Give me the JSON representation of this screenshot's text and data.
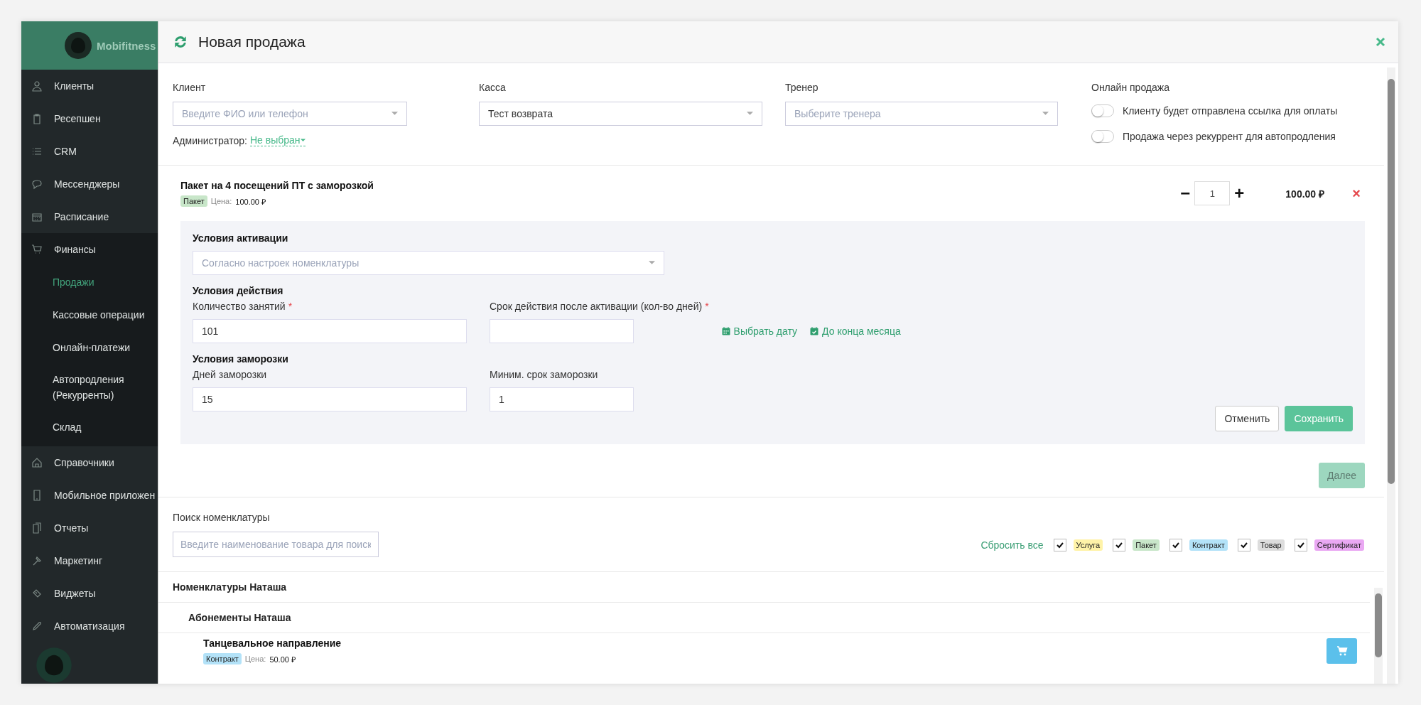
{
  "sidebar": {
    "brand": "Mobifitness",
    "items": [
      {
        "label": "Клиенты",
        "selected": false
      },
      {
        "label": "Ресепшен",
        "selected": false
      },
      {
        "label": "CRM",
        "selected": false
      },
      {
        "label": "Мессенджеры",
        "selected": false
      },
      {
        "label": "Расписание",
        "selected": false
      },
      {
        "label": "Финансы",
        "selected": false,
        "expanded": true,
        "children": [
          {
            "label": "Продажи",
            "selected": true
          },
          {
            "label": "Кассовые операции",
            "selected": false
          },
          {
            "label": "Онлайн-платежи",
            "selected": false
          },
          {
            "label": "Автопродления (Рекурренты)",
            "selected": false
          },
          {
            "label": "Склад",
            "selected": false
          }
        ]
      },
      {
        "label": "Справочники",
        "selected": false
      },
      {
        "label": "Мобильное приложен",
        "selected": false
      },
      {
        "label": "Отчеты",
        "selected": false
      },
      {
        "label": "Маркетинг",
        "selected": false
      },
      {
        "label": "Виджеты",
        "selected": false
      },
      {
        "label": "Автоматизация",
        "selected": false
      }
    ]
  },
  "modal": {
    "title": "Новая продажа",
    "fields": [
      {
        "label": "Клиент",
        "placeholder": "Введите ФИО или телефон"
      },
      {
        "label": "Касса",
        "value": "Тест возврата"
      },
      {
        "label": "Тренер",
        "placeholder": "Выберите тренера"
      }
    ],
    "administrator": {
      "label": "Администратор:",
      "value": "Не выбран"
    },
    "online": {
      "label": "Онлайн продажа",
      "toggles": [
        {
          "label": "Клиенту будет отправлена ссылка для оплаты",
          "on": false
        },
        {
          "label": "Продажа через рекуррент для автопродления",
          "on": false
        }
      ]
    },
    "item": {
      "title": "Пакет на 4 посещений ПТ с заморозкой",
      "tag": {
        "label": "Пакет",
        "color": "#c8e6c9"
      },
      "price_label": "Цена:",
      "price": "100.00 ₽",
      "quantity": "1",
      "minus": "−",
      "plus": "+",
      "total": "100.00 ₽",
      "remove": "×",
      "activation": {
        "heading": "Условия активации",
        "placeholder": "Согласно настроек номенклатуры"
      },
      "action": {
        "heading": "Условия действия",
        "fields": [
          {
            "label": "Количество занятий",
            "required_mark": "*",
            "value": "101"
          },
          {
            "label": "Срок действия после активации (кол-во дней)",
            "required_mark": "*"
          }
        ],
        "links": [
          "Выбрать дату",
          "До конца месяца"
        ]
      },
      "freeze": {
        "heading": "Условия заморозки",
        "fields": [
          {
            "label": "Дней заморозки",
            "value": "15"
          },
          {
            "label": "Миним. срок заморозки",
            "value": "1"
          }
        ]
      },
      "cancel": "Отменить",
      "save": "Сохранить"
    },
    "next": {
      "label": "Далее",
      "disabled": true
    },
    "search": {
      "label": "Поиск номенклатуры",
      "placeholder": "Введите наименование товара для поиск"
    },
    "reset": "Сбросить все",
    "filters": [
      {
        "label": "Услуга",
        "color": "#fff3a8",
        "checked": true
      },
      {
        "label": "Пакет",
        "color": "#c8e6c9",
        "checked": true
      },
      {
        "label": "Контракт",
        "color": "#b3e2f8",
        "checked": true
      },
      {
        "label": "Товар",
        "color": "#dddddd",
        "checked": true
      },
      {
        "label": "Сертификат",
        "color": "#eaa8f3",
        "checked": true
      }
    ],
    "catalog": [
      {
        "title": "Номенклатуры Наташа",
        "children": [
          {
            "title": "Абонементы Наташа",
            "children": [
              {
                "title": "Танцевальное направление",
                "tag": {
                  "label": "Контракт",
                  "color": "#b3e2f8"
                },
                "price_label": "Цена:",
                "price": "50.00 ₽"
              }
            ]
          }
        ]
      }
    ]
  }
}
